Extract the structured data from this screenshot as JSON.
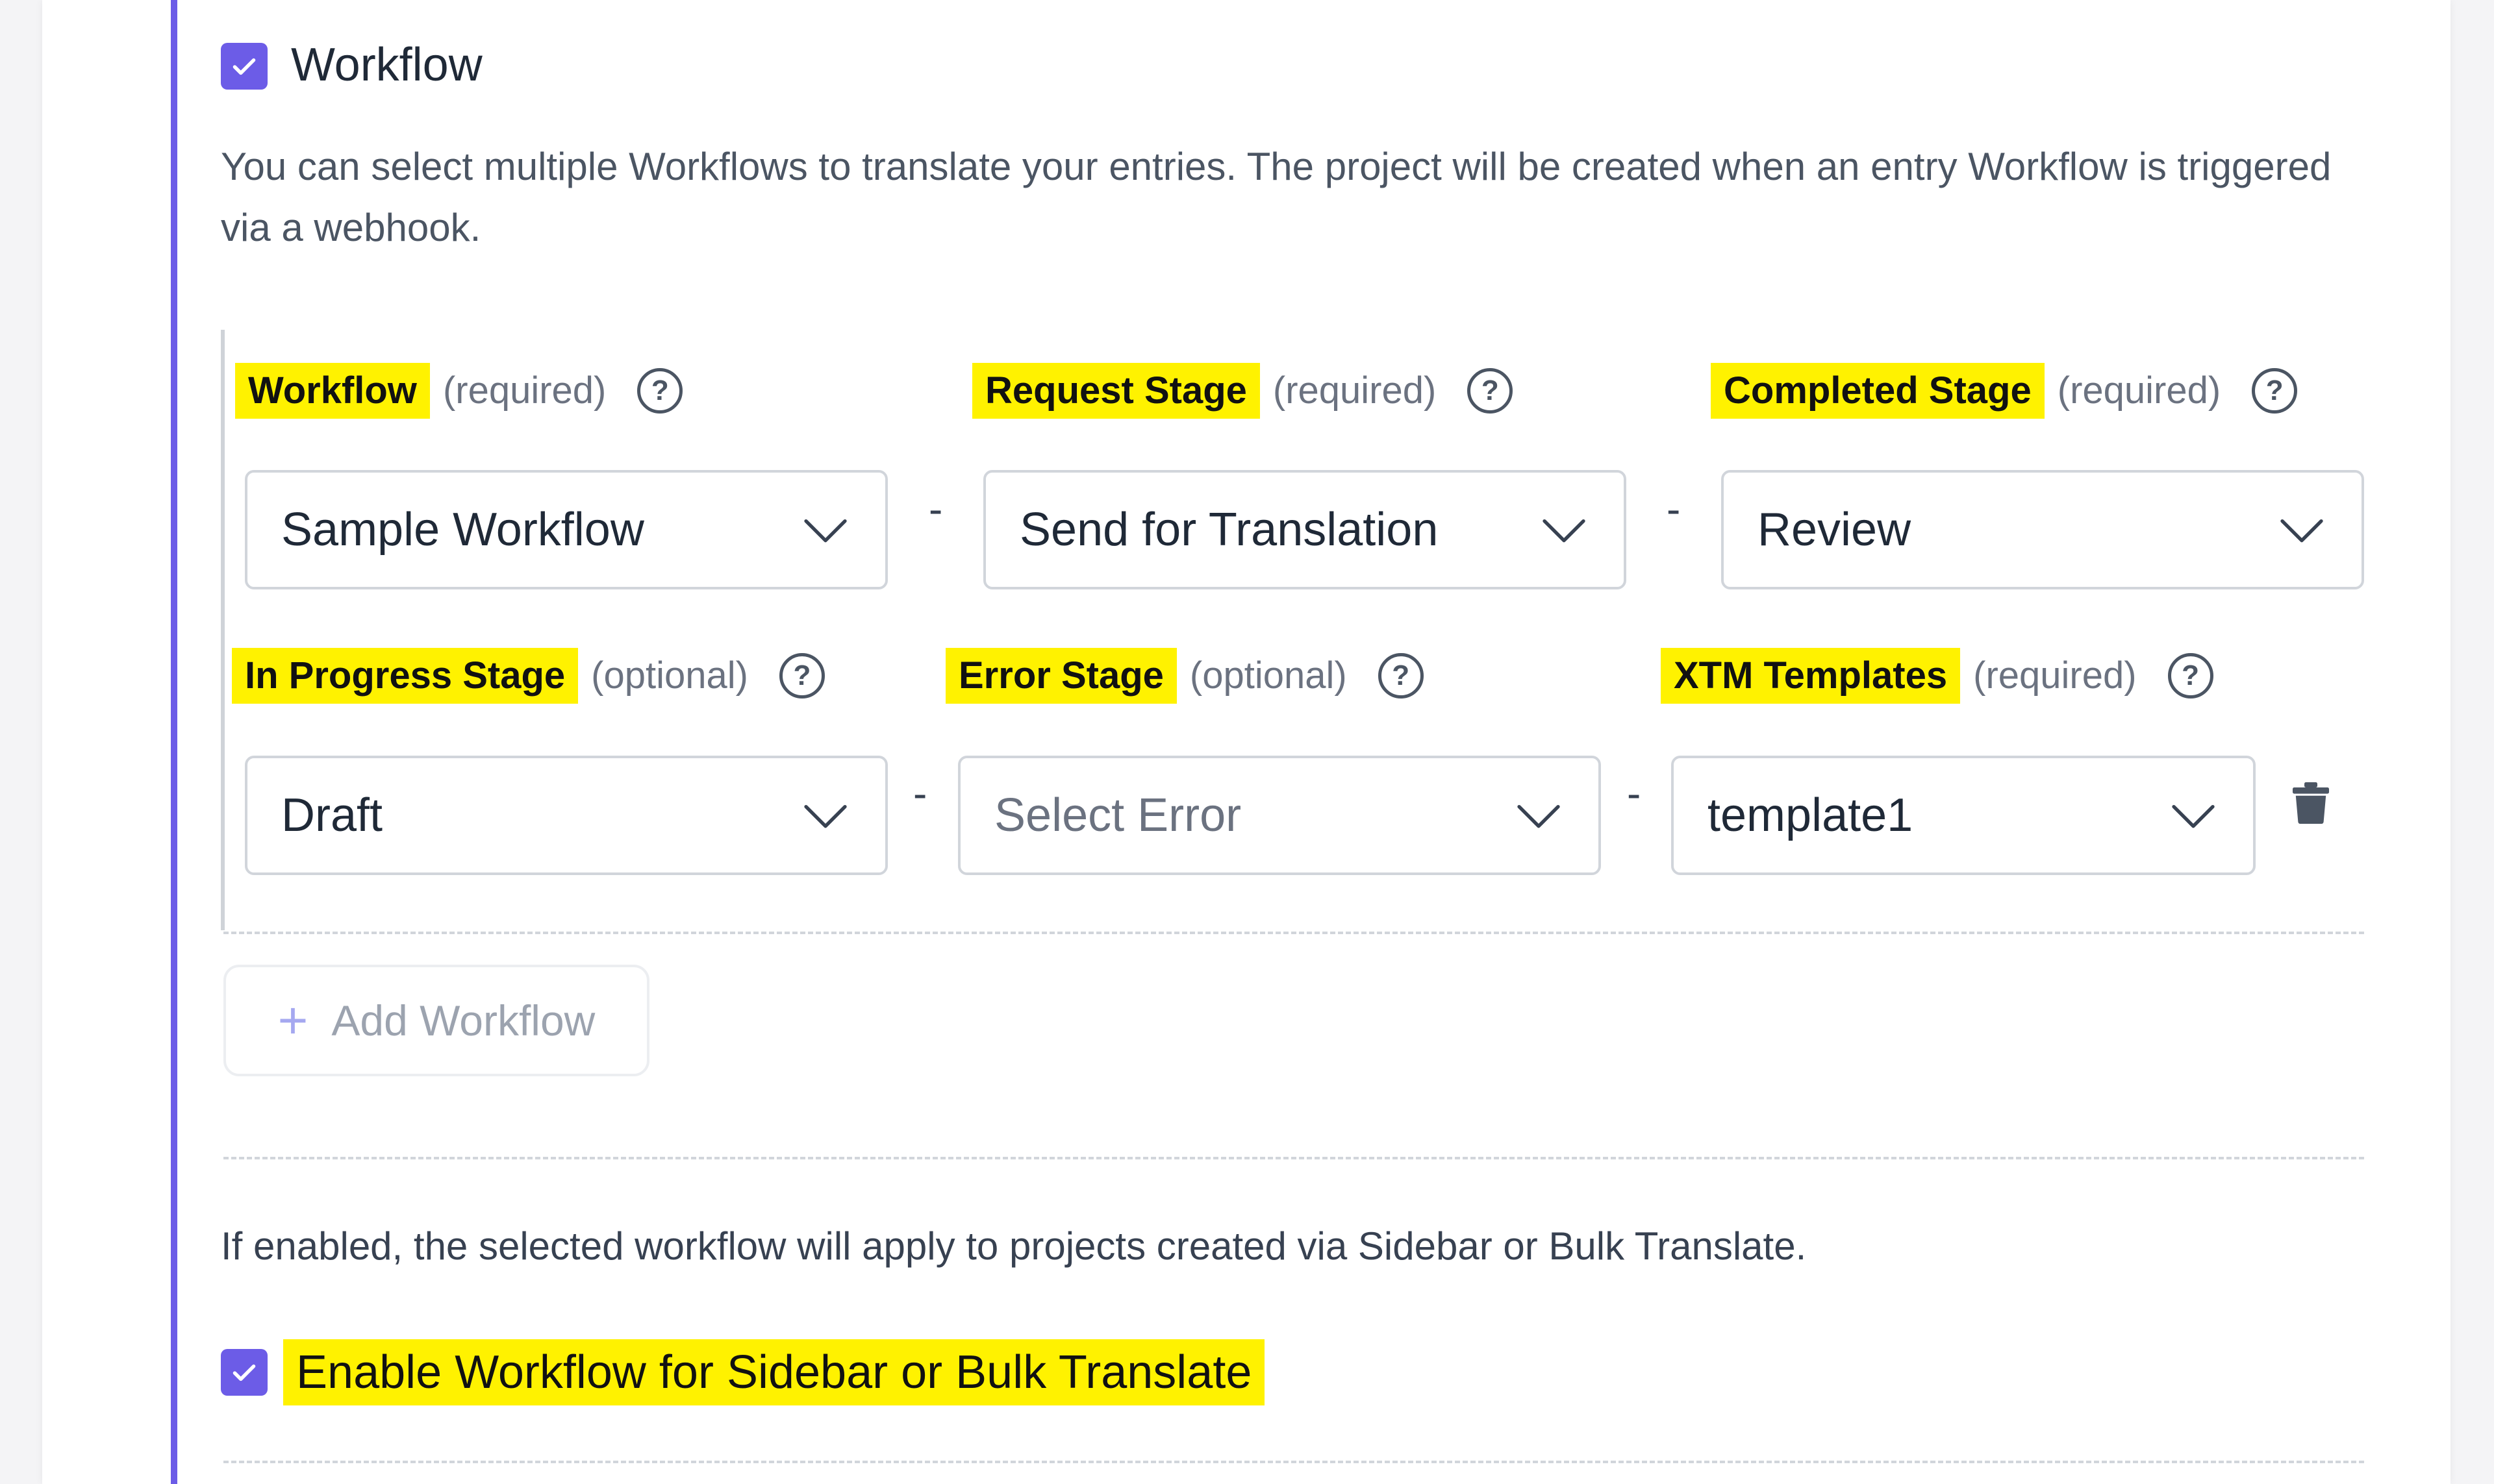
{
  "workflow_section": {
    "checked": true,
    "title": "Workflow",
    "description": "You can select multiple Workflows to translate your entries. The project will be created when an entry Workflow is triggered via a webhook."
  },
  "fields": {
    "workflow": {
      "label": "Workflow",
      "qualifier": "(required)",
      "help": "?",
      "value": "Sample Workflow"
    },
    "request_stage": {
      "label": "Request Stage",
      "qualifier": "(required)",
      "help": "?",
      "value": "Send for Translation"
    },
    "completed_stage": {
      "label": "Completed Stage",
      "qualifier": "(required)",
      "help": "?",
      "value": "Review"
    },
    "in_progress_stage": {
      "label": "In Progress Stage",
      "qualifier": "(optional)",
      "help": "?",
      "value": "Draft"
    },
    "error_stage": {
      "label": "Error Stage",
      "qualifier": "(optional)",
      "help": "?",
      "placeholder": "Select Error"
    },
    "xtm_templates": {
      "label": "XTM Templates",
      "qualifier": "(required)",
      "help": "?",
      "value": "template1"
    }
  },
  "separator": "-",
  "add_workflow": {
    "label": "Add Workflow",
    "icon": "plus-icon"
  },
  "sidebar_bulk": {
    "info": "If enabled, the selected workflow will apply to projects created via Sidebar or Bulk Translate.",
    "checked": true,
    "label": "Enable Workflow for Sidebar or Bulk Translate"
  },
  "colors": {
    "accent": "#6c5ce7",
    "highlight": "#fff200",
    "border": "#d1d5db"
  }
}
